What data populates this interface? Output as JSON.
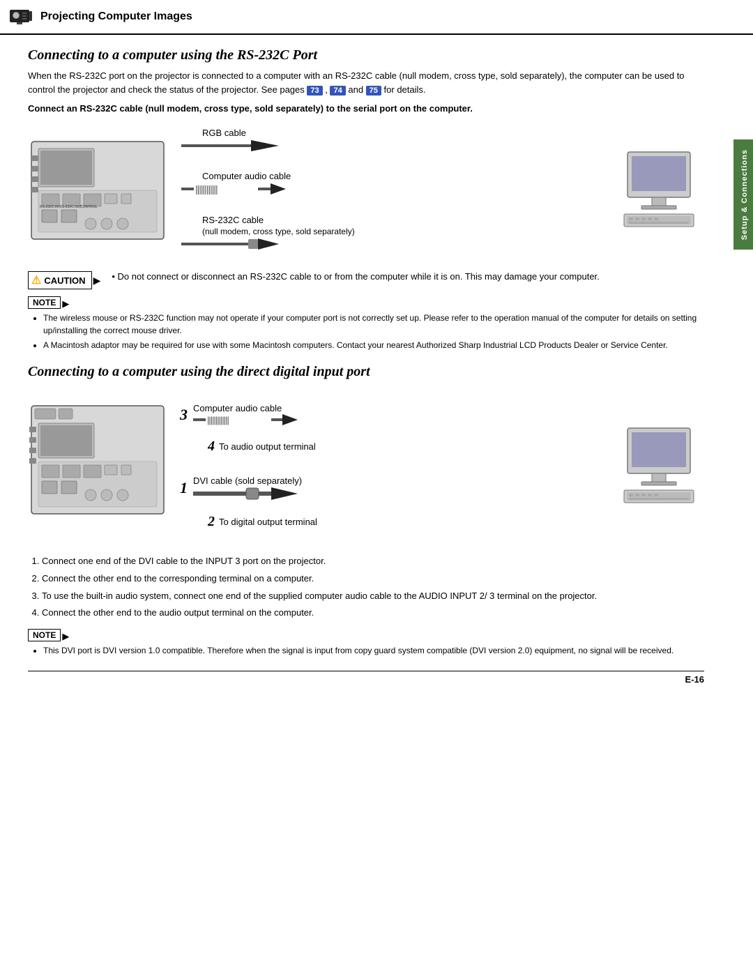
{
  "header": {
    "title": "Projecting Computer Images",
    "icon_alt": "projector-icon"
  },
  "sidebar_tab": {
    "label": "Setup & Connections",
    "icon_alt": "setup-connections-icon"
  },
  "section1": {
    "title": "Connecting to a computer using the RS-232C Port",
    "intro": "When the RS-232C port on the projector is connected to a computer with an RS-232C cable (null modem, cross type, sold separately), the computer can be used to control the projector and check the status of the projector.",
    "see_pages": "See pages",
    "page_refs": [
      "73",
      "74",
      "75"
    ],
    "page_refs_sep": [
      ",",
      "and"
    ],
    "for_details": "for details.",
    "bold_instruction": "Connect an RS-232C cable (null modem, cross type, sold separately) to the serial port on the computer.",
    "cable_labels": {
      "rgb": "RGB cable",
      "audio": "Computer audio cable",
      "rs232": "RS-232C cable",
      "rs232_sub": "(null modem, cross type, sold separately)"
    }
  },
  "caution": {
    "badge_label": "CAUTION",
    "text": "Do not connect or disconnect an RS-232C cable to or from the computer while it is on. This may damage your computer."
  },
  "note1": {
    "badge_label": "NOTE",
    "items": [
      "The wireless mouse or RS-232C function may not operate if your computer port is not correctly set up. Please refer to the operation manual of the computer for details on setting up/installing the correct mouse driver.",
      "A Macintosh adaptor may be required for use with some Macintosh computers. Contact your nearest Authorized Sharp Industrial LCD Products Dealer or Service Center."
    ]
  },
  "section2": {
    "title": "Connecting to a computer using the direct digital input port",
    "cable_labels": {
      "audio": "Computer audio cable",
      "audio_to": "To audio output terminal",
      "dvi": "DVI cable (sold separately)",
      "dvi_to": "To digital output terminal"
    },
    "step_numbers": {
      "step3": "3",
      "step4": "4",
      "step1": "1",
      "step2": "2"
    },
    "steps": [
      "Connect one end of the DVI cable to the INPUT 3 port on the projector.",
      "Connect the other end to the corresponding terminal on a computer.",
      "To use the built-in audio system, connect one end of the supplied computer audio cable to the AUDIO INPUT 2/ 3 terminal on the projector.",
      "Connect the other end to the audio output terminal on the computer."
    ]
  },
  "note2": {
    "badge_label": "NOTE",
    "items": [
      "This DVI port is DVI version 1.0 compatible. Therefore when the signal is input from copy guard system compatible (DVI version 2.0) equipment, no signal will be received."
    ]
  },
  "page_number": "E-16"
}
